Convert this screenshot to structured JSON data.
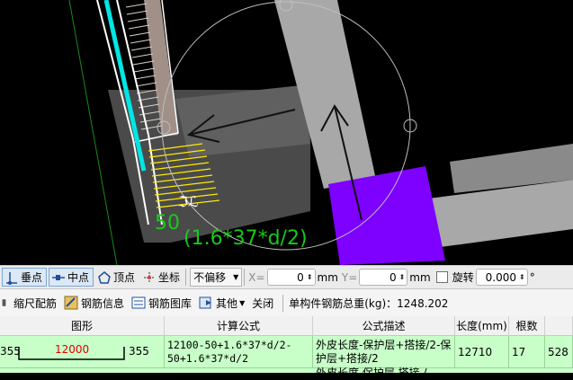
{
  "canvas": {
    "dim_label_top": "50",
    "dim_label_formula": "(1.6*37*d/2)"
  },
  "snapbar": {
    "perpendicular": "垂点",
    "midpoint": "中点",
    "vertex": "顶点",
    "coordinate": "坐标",
    "offset_value": "不偏移",
    "x_label": "X=",
    "x_value": "0",
    "x_unit": "mm",
    "y_label": "Y=",
    "y_value": "0",
    "y_unit": "mm",
    "rotate_label": "旋转",
    "rotate_value": "0.000",
    "degree": "°"
  },
  "toolbar": {
    "scale_rebar": "缩尺配筋",
    "rebar_info": "钢筋信息",
    "rebar_library": "钢筋图库",
    "other": "其他",
    "close": "关闭",
    "total_weight": "单构件钢筋总重(kg)：1248.202"
  },
  "grid": {
    "headers": [
      "图形",
      "计算公式",
      "公式描述",
      "长度(mm)",
      "根数"
    ],
    "row1": {
      "shape_left": "355",
      "shape_mid": "12000",
      "shape_right": "355",
      "formula": "12100-50+1.6*37*d/2-50+1.6*37*d/2",
      "description": "外皮长度-保护层+搭接/2-保护层+搭接/2",
      "length": "12710",
      "count": "17",
      "extra": "528"
    },
    "row2": {
      "description_partial": "外皮长度 保护层 搭接 /"
    }
  },
  "colors": {
    "beam_gray": "#a8a8a8",
    "cyan_bar": "#00e5e5",
    "purple_column": "#7e00ff",
    "dim_green": "#19c919",
    "row_green": "#c8ffc8"
  }
}
